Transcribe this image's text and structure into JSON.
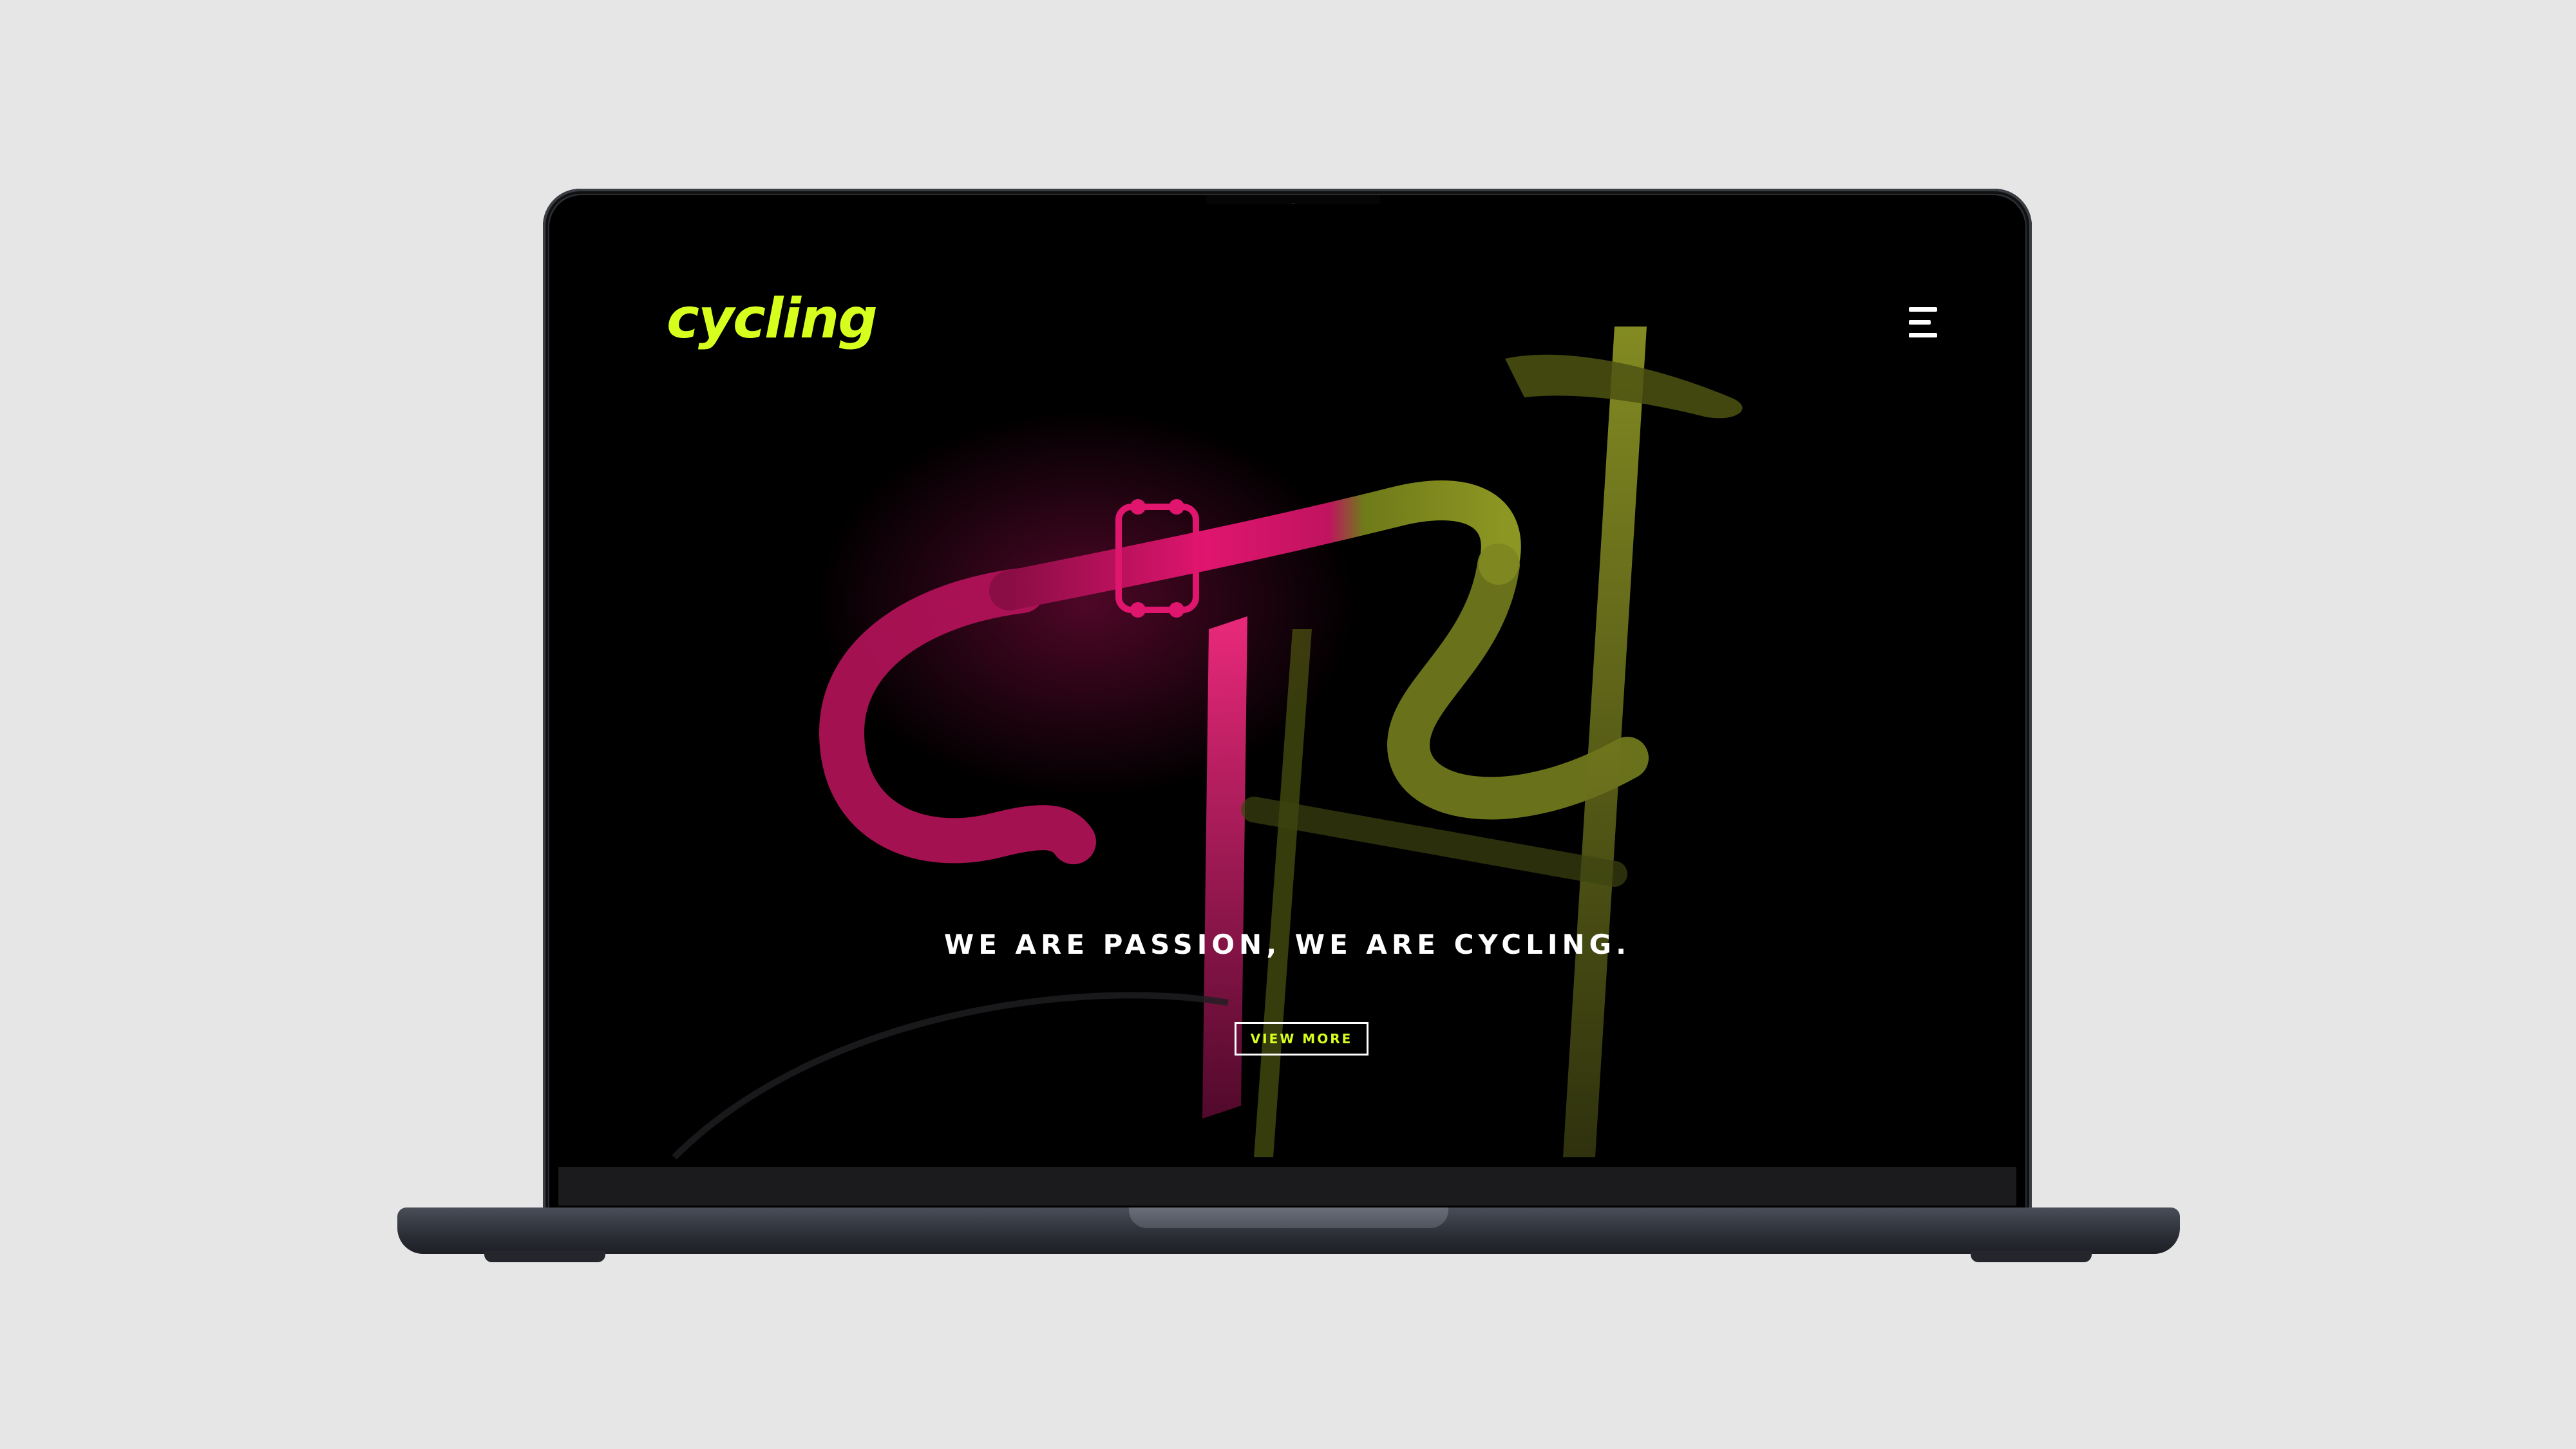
{
  "site": {
    "logo_text": "cycling",
    "menu_icon": "hamburger-menu-icon"
  },
  "hero": {
    "headline": "WE ARE PASSION, WE ARE CYCLING.",
    "cta_label": "VIEW MORE"
  },
  "colors": {
    "background": "#e6e6e6",
    "screen": "#000000",
    "accent_lime": "#d7ff1e",
    "accent_magenta": "#e0156e",
    "text": "#ffffff",
    "laptop_body": "#2b2d33"
  }
}
